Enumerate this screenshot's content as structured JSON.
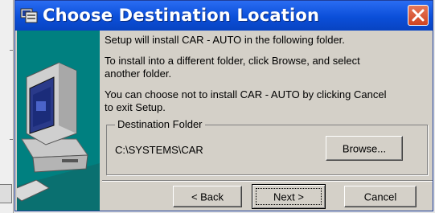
{
  "window": {
    "title": "Choose Destination Location",
    "close_label": "X"
  },
  "messages": {
    "line1": "Setup will install CAR - AUTO in the following folder.",
    "line2": "To install into a different folder, click Browse, and select",
    "line3": "another folder.",
    "line4": "You can choose not to install CAR - AUTO by clicking Cancel",
    "line5": "to exit Setup."
  },
  "destination": {
    "group_label": "Destination Folder",
    "path": "C:\\SYSTEMS\\CAR",
    "browse_label": "Browse..."
  },
  "buttons": {
    "back": "< Back",
    "next": "Next >",
    "cancel": "Cancel"
  },
  "colors": {
    "titlebar": "#0b4fd9",
    "banner": "#008080",
    "dialog_bg": "#d4d0c8",
    "close": "#cf4421"
  },
  "icons": {
    "title": "installer-icon",
    "banner": "computer-icon",
    "close": "close-icon"
  }
}
